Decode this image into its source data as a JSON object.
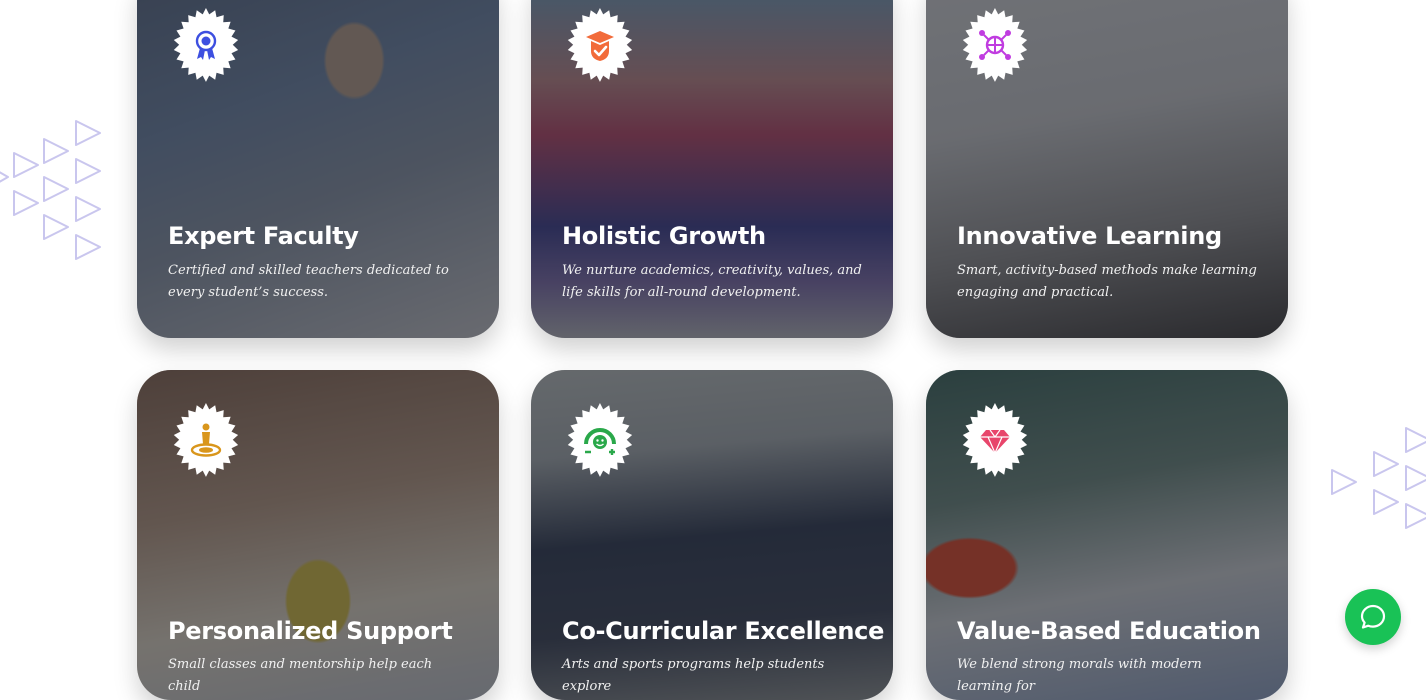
{
  "cards": [
    {
      "title": "Expert Faculty",
      "description": "Certified and skilled teachers dedicated to every student’s success.",
      "icon": "award-ribbon-icon",
      "icon_color": "#3d4fe0"
    },
    {
      "title": "Holistic Growth",
      "description": "We nurture academics, creativity, values, and life skills for all-round development.",
      "icon": "graduation-shield-icon",
      "icon_color": "#f26b3a"
    },
    {
      "title": "Innovative Learning",
      "description": "Smart, activity-based methods make learning engaging and practical.",
      "icon": "network-globe-icon",
      "icon_color": "#c03ce0"
    },
    {
      "title": "Personalized Support",
      "description": "Small classes and mentorship help each child",
      "icon": "person-target-icon",
      "icon_color": "#d9961c"
    },
    {
      "title": "Co-Curricular Excellence",
      "description": "Arts and sports programs help students explore",
      "icon": "happy-meter-icon",
      "icon_color": "#2aa84a"
    },
    {
      "title": "Value-Based Education",
      "description": "We blend strong morals with modern learning for",
      "icon": "diamond-icon",
      "icon_color": "#e8456b"
    }
  ],
  "chat": {
    "icon": "chat-bubble-icon",
    "color": "#19c256"
  },
  "decoration": {
    "triangle_color": "#c9c6ee"
  }
}
